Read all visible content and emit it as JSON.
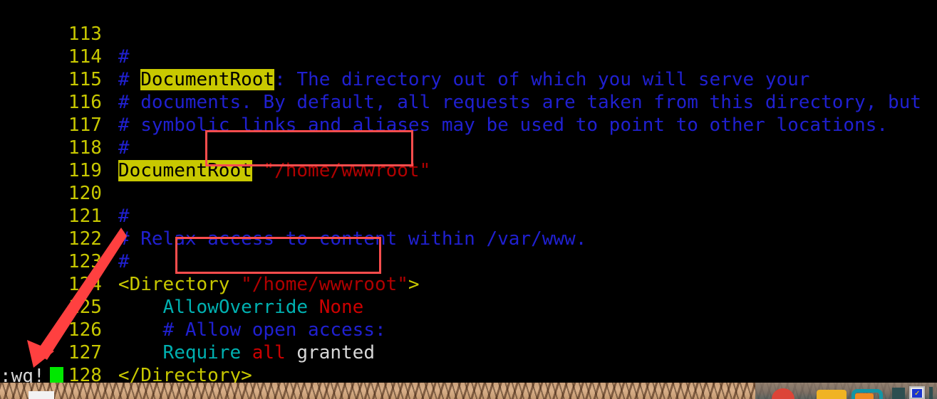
{
  "window": {
    "app": "vim",
    "mode_command": ":wq!"
  },
  "editor": {
    "first_line_number": 113,
    "last_line_number": 128,
    "lines": [
      {
        "num": "113",
        "text": ""
      },
      {
        "num": "114",
        "text": "#"
      },
      {
        "num": "115",
        "text": "# DocumentRoot: The directory out of which you will serve your"
      },
      {
        "num": "116",
        "text": "# documents. By default, all requests are taken from this directory, but"
      },
      {
        "num": "117",
        "text": "# symbolic links and aliases may be used to point to other locations."
      },
      {
        "num": "118",
        "text": "#"
      },
      {
        "num": "119",
        "text": "DocumentRoot \"/home/wwwroot\""
      },
      {
        "num": "120",
        "text": ""
      },
      {
        "num": "121",
        "text": "#"
      },
      {
        "num": "122",
        "text": "# Relax access to content within /var/www."
      },
      {
        "num": "123",
        "text": "#"
      },
      {
        "num": "124",
        "text": "<Directory \"/home/wwwroot\">"
      },
      {
        "num": "125",
        "text": "    AllowOverride None"
      },
      {
        "num": "126",
        "text": "    # Allow open access:"
      },
      {
        "num": "127",
        "text": "    Require all granted"
      },
      {
        "num": "128",
        "text": "</Directory>"
      }
    ],
    "tokens": {
      "l114_hash": "#",
      "l115_hash": "#",
      "l115_highlight": "DocumentRoot",
      "l115_rest": ": The directory out of which you will serve your",
      "l116_hash": "#",
      "l116_rest": " documents. By default, all requests are taken from this directory, but",
      "l117_hash": "#",
      "l117_rest": " symbolic links and aliases may be used to point to other locations.",
      "l118_hash": "#",
      "l119_highlight": "DocumentRoot",
      "l119_space": " ",
      "l119_value": "\"/home/wwwroot\"",
      "l121_hash": "#",
      "l122_hash": "#",
      "l122_rest": " Relax access to content within /var/www.",
      "l123_hash": "#",
      "l124_open": "<Directory ",
      "l124_value": "\"/home/wwwroot\"",
      "l124_close": ">",
      "l125_indent": "    ",
      "l125_directive": "AllowOverride",
      "l125_space": " ",
      "l125_value": "None",
      "l126_indent": "    ",
      "l126_comment": "# Allow open access:",
      "l127_indent": "    ",
      "l127_directive": "Require",
      "l127_space": " ",
      "l127_value": "all",
      "l127_tail": " granted",
      "l128_close": "</Directory>"
    }
  },
  "annotations": {
    "box_1_label": "highlighted DocumentRoot value",
    "box_2_label": "highlighted Directory path value",
    "arrow_label": "arrow pointing to vim command line"
  },
  "colors": {
    "background": "#000000",
    "line_number": "#c8c800",
    "comment": "#2020d0",
    "keyword": "#c8c800",
    "directive": "#00b0b0",
    "value_red": "#cc0000",
    "string_red": "#b00000",
    "plain_text": "#d8d8d8",
    "search_highlight_bg": "#c8c800",
    "annotation_red": "#ff4d4d",
    "cursor_green": "#00e800"
  },
  "taskbar": {
    "icons": [
      "file-manager-icon",
      "browser-red-icon",
      "amazon-icon",
      "orange-app-icon",
      "teal-app-icon",
      "dark-panel-icon",
      "blue-checkbox-icon",
      "side-bar-icon"
    ]
  }
}
